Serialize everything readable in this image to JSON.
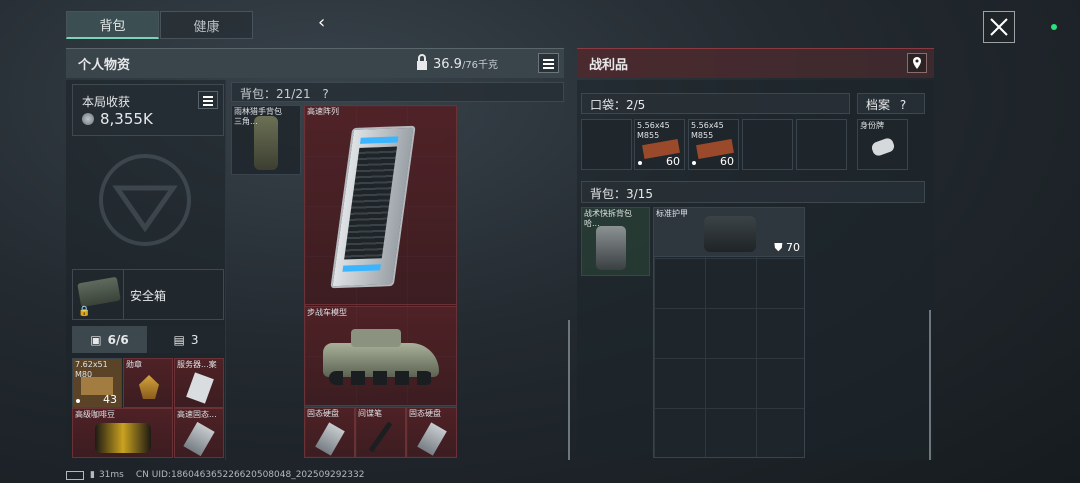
{
  "tabs": {
    "backpack": "背包",
    "health": "健康"
  },
  "personal": {
    "title": "个人物资",
    "weight_value": "36.9",
    "weight_max": "/76千克"
  },
  "loot_panel": {
    "title": "战利品"
  },
  "earnings": {
    "label": "本局收获",
    "value": "8,355K"
  },
  "safe_box": {
    "label": "安全箱"
  },
  "stash_tabs": {
    "a": "6/6",
    "b": "3"
  },
  "stash_items": [
    {
      "label": "7.62x51\nM80",
      "count": "43"
    },
    {
      "label": "勋章"
    },
    {
      "label": "服务器...案"
    },
    {
      "label": "高级咖啡豆"
    },
    {
      "label": "高速固态..."
    }
  ],
  "backpack_equipped": {
    "label": "雨林猎手背包\n三角..."
  },
  "backpack_header": {
    "label": "背包：21/21",
    "help": "?"
  },
  "backpack_items": {
    "array": "高速阵列",
    "ifv": "步战车模型",
    "ssd1": "固态硬盘",
    "pen": "间谍笔",
    "ssd2": "固态硬盘"
  },
  "pocket": {
    "label": "口袋：2/5",
    "ammo1": {
      "label": "5.56x45\nM855",
      "count": "60"
    },
    "ammo2": {
      "label": "5.56x45\nM855",
      "count": "60"
    }
  },
  "archive": {
    "label": "档案",
    "help": "?",
    "dogtag": "身份牌"
  },
  "loot_backpack": {
    "label": "背包：3/15",
    "pack": "战术快拆背包\n哈...",
    "armor": "标准护甲",
    "armor_value": "70"
  },
  "footer": {
    "ping": "31ms",
    "uid": "CN UID:18604636522662050804​8_202509292332"
  }
}
